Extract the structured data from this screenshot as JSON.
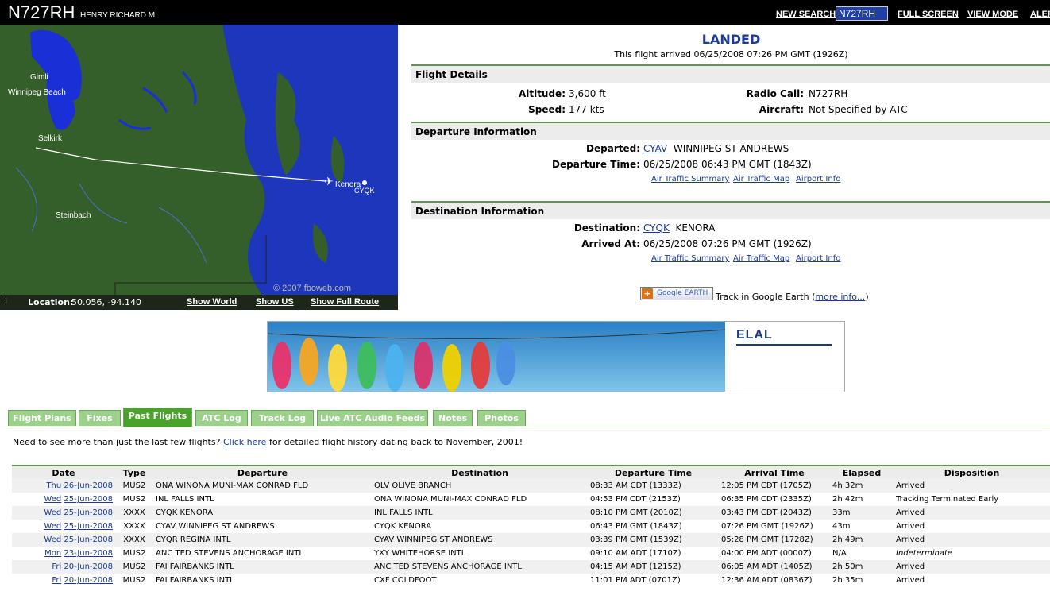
{
  "header": {
    "tail_number": "N727RH",
    "owner": "HENRY RICHARD M",
    "links": {
      "new_search": "NEW SEARCH",
      "full_screen": "FULL SCREEN",
      "view_mode": "VIEW MODE",
      "alerts": "ALER"
    },
    "search_value": "N727RH"
  },
  "map": {
    "labels": {
      "gimli": "Gimli",
      "winnipeg_beach": "Winnipeg Beach",
      "selkirk": "Selkirk",
      "steinbach": "Steinbach",
      "kenora": "Kenora",
      "cyqk": "CYQK"
    },
    "watermark": "© 2007 fboweb.com",
    "location_label": "Location:",
    "location_value": "50.056, -94.140",
    "show_world": "Show World",
    "show_us": "Show US",
    "show_full_route": "Show Full Route",
    "colors": {
      "land": "#345f2a",
      "water": "#1a2fd6",
      "route": "#ffffff"
    }
  },
  "status": {
    "title": "LANDED",
    "subtitle": "This flight arrived 06/25/2008 07:26 PM GMT (1926Z)"
  },
  "flight_details": {
    "heading": "Flight Details",
    "altitude_label": "Altitude:",
    "altitude": "3,600 ft",
    "speed_label": "Speed:",
    "speed": "177 kts",
    "radio_label": "Radio Call:",
    "radio": "N727RH",
    "aircraft_label": "Aircraft:",
    "aircraft": "Not Specified by ATC"
  },
  "departure": {
    "heading": "Departure Information",
    "departed_label": "Departed:",
    "code": "CYAV",
    "name": "WINNIPEG ST ANDREWS",
    "time_label": "Departure Time:",
    "time": "06/25/2008 06:43 PM GMT (1843Z)",
    "links": [
      "Air Traffic Summary",
      "Air Traffic Map",
      "Airport Info"
    ]
  },
  "destination": {
    "heading": "Destination Information",
    "dest_label": "Destination:",
    "code": "CYQK",
    "name": "KENORA",
    "arrived_label": "Arrived At:",
    "time": "06/25/2008 07:26 PM GMT (1926Z)",
    "links": [
      "Air Traffic Summary",
      "Air Traffic Map",
      "Airport Info"
    ]
  },
  "google_earth": {
    "button": "Google EARTH",
    "text": "Track in Google Earth (",
    "more": "more info...",
    "close": ")"
  },
  "banner": {
    "brand": "ELAL"
  },
  "tabs": [
    "Flight Plans",
    "Fixes",
    "Past Flights",
    "ATC Log",
    "Track Log",
    "Live ATC Audio Feeds",
    "Notes",
    "Photos"
  ],
  "history_note": {
    "prefix": "Need to see more than just the last few flights?",
    "link": "Click here",
    "suffix": "for detailed flight history dating back to November, 2001!"
  },
  "flights_table": {
    "headers": [
      "Date",
      "Type",
      "Departure",
      "Destination",
      "Departure Time",
      "Arrival Time",
      "Elapsed",
      "Disposition"
    ],
    "rows": [
      [
        "Thu",
        "26-Jun-2008",
        "MUS2",
        "ONA  WINONA MUNI-MAX CONRAD FLD",
        "OLV  OLIVE BRANCH",
        "08:33 AM CDT (1333Z)",
        "12:05 PM CDT (1705Z)",
        "4h 32m",
        "Arrived"
      ],
      [
        "Wed",
        "25-Jun-2008",
        "MUS2",
        "INL  FALLS INTL",
        "ONA  WINONA MUNI-MAX CONRAD FLD",
        "04:53 PM CDT (2153Z)",
        "06:35 PM CDT (2335Z)",
        "2h 42m",
        "Tracking Terminated Early"
      ],
      [
        "Wed",
        "25-Jun-2008",
        "XXXX",
        "CYQK  KENORA",
        "INL  FALLS INTL",
        "08:10 PM GMT (2010Z)",
        "03:43 PM CDT (2043Z)",
        "33m",
        "Arrived"
      ],
      [
        "Wed",
        "25-Jun-2008",
        "XXXX",
        "CYAV  WINNIPEG ST ANDREWS",
        "CYQK  KENORA",
        "06:43 PM GMT (1843Z)",
        "07:26 PM GMT (1926Z)",
        "43m",
        "Arrived"
      ],
      [
        "Wed",
        "25-Jun-2008",
        "XXXX",
        "CYQR  REGINA INTL",
        "CYAV  WINNIPEG ST ANDREWS",
        "03:39 PM GMT (1539Z)",
        "05:28 PM GMT (1728Z)",
        "2h 49m",
        "Arrived"
      ],
      [
        "Mon",
        "23-Jun-2008",
        "MUS2",
        "ANC  TED STEVENS ANCHORAGE INTL",
        "YXY  WHITEHORSE INTL",
        "09:10 AM ADT (1710Z)",
        "04:00 PM ADT (0000Z)",
        "N/A",
        "Indeterminate"
      ],
      [
        "Fri",
        "20-Jun-2008",
        "MUS2",
        "FAI  FAIRBANKS INTL",
        "ANC  TED STEVENS ANCHORAGE INTL",
        "04:15 AM ADT (1215Z)",
        "06:05 AM ADT (1405Z)",
        "2h 50m",
        "Arrived"
      ],
      [
        "Fri",
        "20-Jun-2008",
        "MUS2",
        "FAI  FAIRBANKS INTL",
        "CXF  COLDFOOT",
        "11:01 PM ADT (0701Z)",
        "12:36 AM ADT (0836Z)",
        "2h 35m",
        "Arrived"
      ]
    ]
  }
}
